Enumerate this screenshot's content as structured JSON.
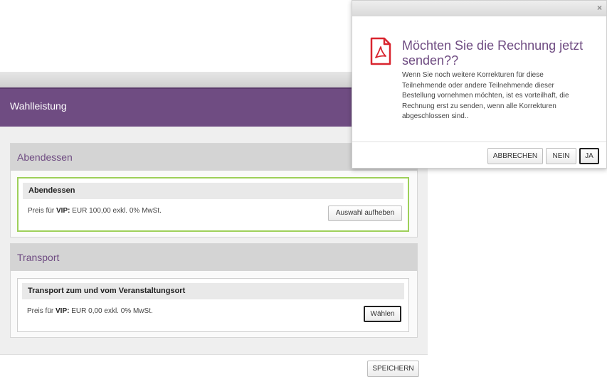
{
  "background_modal": {
    "title": "Wahlleistung",
    "sections": [
      {
        "heading": "Abendessen",
        "item": {
          "name": "Abendessen",
          "price_prefix": "Preis für ",
          "price_category": "VIP:",
          "price_text": " EUR 100,00 exkl. 0% MwSt.",
          "button_label": "Auswahl aufheben"
        }
      },
      {
        "heading": "Transport",
        "item": {
          "name": "Transport zum und vom Veranstaltungsort",
          "price_prefix": "Preis für ",
          "price_category": "VIP:",
          "price_text": " EUR 0,00 exkl. 0% MwSt.",
          "button_label": "Wählen"
        }
      }
    ],
    "save_label": "SPEICHERN"
  },
  "dialog": {
    "close_glyph": "×",
    "icon": "pdf-file-icon",
    "title": "Möchten Sie die Rechnung jetzt senden??",
    "body": "Wenn Sie noch weitere Korrekturen für diese Teilnehmende oder andere Teilnehmende dieser Bestellung vornehmen möchten, ist es vorteilhaft, die Rechnung erst zu senden, wenn alle Korrekturen abgeschlossen sind..",
    "buttons": {
      "cancel": "ABBRECHEN",
      "no": "NEIN",
      "yes": "JA"
    }
  },
  "colors": {
    "accent_purple": "#6f4c82",
    "selected_green": "#9ed05a",
    "pdf_red": "#d9252f"
  }
}
